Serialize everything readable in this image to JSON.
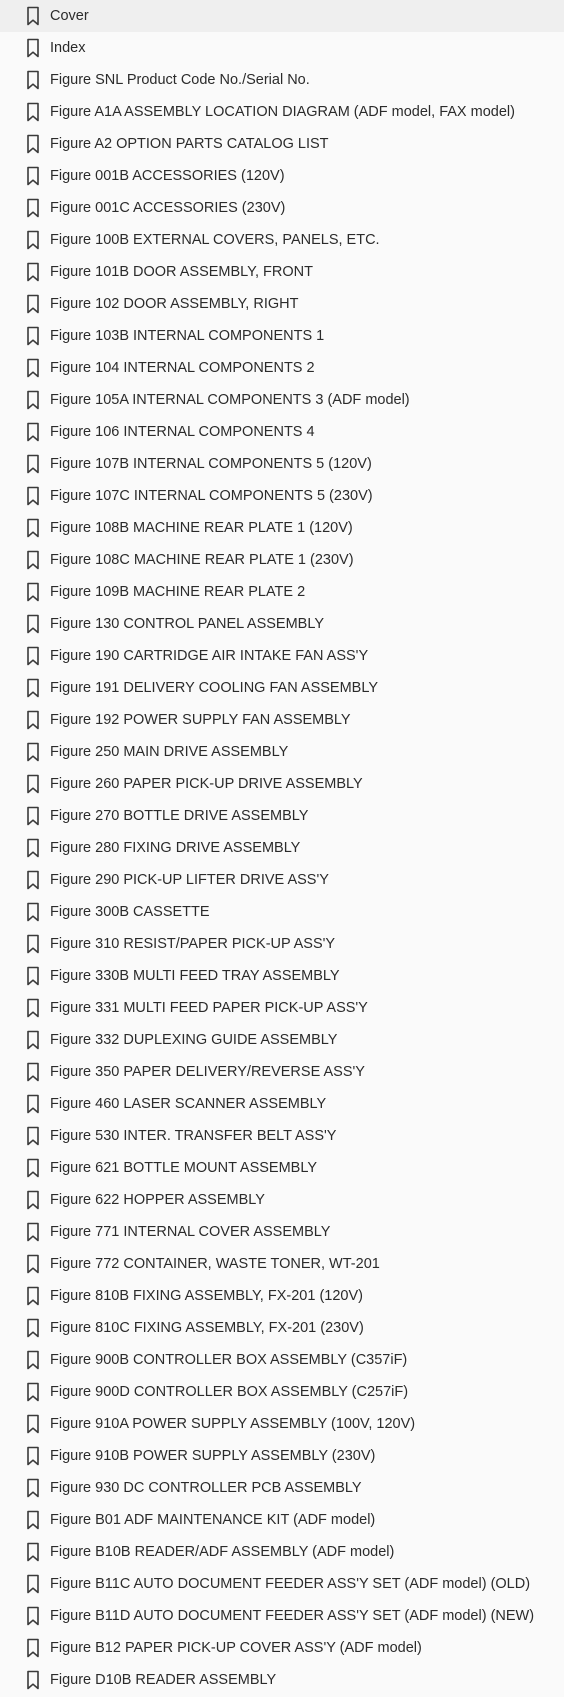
{
  "bookmarks": [
    {
      "label": "Cover",
      "icon": "bookmark-icon"
    },
    {
      "label": "Index",
      "icon": "bookmark-icon"
    },
    {
      "label": "Figure SNL Product Code No./Serial No.",
      "icon": "bookmark-icon"
    },
    {
      "label": "Figure A1A ASSEMBLY LOCATION DIAGRAM (ADF model, FAX model)",
      "icon": "bookmark-icon"
    },
    {
      "label": "Figure A2 OPTION PARTS CATALOG LIST",
      "icon": "bookmark-icon"
    },
    {
      "label": "Figure 001B ACCESSORIES (120V)",
      "icon": "bookmark-icon"
    },
    {
      "label": "Figure 001C ACCESSORIES (230V)",
      "icon": "bookmark-icon"
    },
    {
      "label": "Figure 100B EXTERNAL COVERS, PANELS, ETC.",
      "icon": "bookmark-icon"
    },
    {
      "label": "Figure 101B DOOR ASSEMBLY, FRONT",
      "icon": "bookmark-icon"
    },
    {
      "label": "Figure 102 DOOR ASSEMBLY, RIGHT",
      "icon": "bookmark-icon"
    },
    {
      "label": "Figure 103B INTERNAL COMPONENTS 1",
      "icon": "bookmark-icon"
    },
    {
      "label": "Figure 104 INTERNAL COMPONENTS 2",
      "icon": "bookmark-icon"
    },
    {
      "label": "Figure 105A INTERNAL COMPONENTS 3 (ADF model)",
      "icon": "bookmark-icon"
    },
    {
      "label": "Figure 106 INTERNAL COMPONENTS 4",
      "icon": "bookmark-icon"
    },
    {
      "label": "Figure 107B INTERNAL COMPONENTS 5 (120V)",
      "icon": "bookmark-icon"
    },
    {
      "label": "Figure 107C INTERNAL COMPONENTS 5 (230V)",
      "icon": "bookmark-icon"
    },
    {
      "label": "Figure 108B MACHINE REAR PLATE 1 (120V)",
      "icon": "bookmark-icon"
    },
    {
      "label": "Figure 108C MACHINE REAR PLATE 1 (230V)",
      "icon": "bookmark-icon"
    },
    {
      "label": "Figure 109B MACHINE REAR PLATE 2",
      "icon": "bookmark-icon"
    },
    {
      "label": "Figure 130 CONTROL PANEL ASSEMBLY",
      "icon": "bookmark-icon"
    },
    {
      "label": "Figure 190 CARTRIDGE AIR INTAKE FAN ASS'Y",
      "icon": "bookmark-icon"
    },
    {
      "label": "Figure 191 DELIVERY COOLING FAN ASSEMBLY",
      "icon": "bookmark-icon"
    },
    {
      "label": "Figure 192 POWER SUPPLY FAN ASSEMBLY",
      "icon": "bookmark-icon"
    },
    {
      "label": "Figure 250 MAIN DRIVE ASSEMBLY",
      "icon": "bookmark-icon"
    },
    {
      "label": "Figure 260 PAPER PICK-UP DRIVE ASSEMBLY",
      "icon": "bookmark-icon"
    },
    {
      "label": "Figure 270 BOTTLE DRIVE ASSEMBLY",
      "icon": "bookmark-icon"
    },
    {
      "label": "Figure 280 FIXING DRIVE ASSEMBLY",
      "icon": "bookmark-icon"
    },
    {
      "label": "Figure 290 PICK-UP LIFTER DRIVE ASS'Y",
      "icon": "bookmark-icon"
    },
    {
      "label": "Figure 300B CASSETTE",
      "icon": "bookmark-icon"
    },
    {
      "label": "Figure 310 RESIST/PAPER PICK-UP ASS'Y",
      "icon": "bookmark-icon"
    },
    {
      "label": "Figure 330B MULTI FEED TRAY ASSEMBLY",
      "icon": "bookmark-icon"
    },
    {
      "label": "Figure 331 MULTI FEED PAPER PICK-UP ASS'Y",
      "icon": "bookmark-icon"
    },
    {
      "label": "Figure 332 DUPLEXING GUIDE ASSEMBLY",
      "icon": "bookmark-icon"
    },
    {
      "label": "Figure 350 PAPER DELIVERY/REVERSE ASS'Y",
      "icon": "bookmark-icon"
    },
    {
      "label": "Figure 460 LASER SCANNER ASSEMBLY",
      "icon": "bookmark-icon"
    },
    {
      "label": "Figure 530 INTER. TRANSFER BELT ASS'Y",
      "icon": "bookmark-icon"
    },
    {
      "label": "Figure 621 BOTTLE MOUNT ASSEMBLY",
      "icon": "bookmark-icon"
    },
    {
      "label": "Figure 622 HOPPER ASSEMBLY",
      "icon": "bookmark-icon"
    },
    {
      "label": "Figure 771 INTERNAL COVER ASSEMBLY",
      "icon": "bookmark-icon"
    },
    {
      "label": "Figure 772 CONTAINER, WASTE TONER, WT-201",
      "icon": "bookmark-icon"
    },
    {
      "label": "Figure 810B FIXING ASSEMBLY, FX-201 (120V)",
      "icon": "bookmark-icon"
    },
    {
      "label": "Figure 810C FIXING ASSEMBLY, FX-201 (230V)",
      "icon": "bookmark-icon"
    },
    {
      "label": "Figure 900B CONTROLLER BOX ASSEMBLY (C357iF)",
      "icon": "bookmark-icon"
    },
    {
      "label": "Figure 900D CONTROLLER BOX ASSEMBLY (C257iF)",
      "icon": "bookmark-icon"
    },
    {
      "label": "Figure 910A POWER SUPPLY ASSEMBLY (100V, 120V)",
      "icon": "bookmark-icon"
    },
    {
      "label": "Figure 910B POWER SUPPLY ASSEMBLY (230V)",
      "icon": "bookmark-icon"
    },
    {
      "label": "Figure 930 DC CONTROLLER PCB ASSEMBLY",
      "icon": "bookmark-icon"
    },
    {
      "label": "Figure B01 ADF MAINTENANCE KIT (ADF model)",
      "icon": "bookmark-icon"
    },
    {
      "label": "Figure B10B READER/ADF ASSEMBLY (ADF model)",
      "icon": "bookmark-icon"
    },
    {
      "label": "Figure B11C AUTO DOCUMENT FEEDER ASS'Y SET (ADF model) (OLD)",
      "icon": "bookmark-icon"
    },
    {
      "label": "Figure B11D AUTO DOCUMENT FEEDER ASS'Y SET (ADF model) (NEW)",
      "icon": "bookmark-icon"
    },
    {
      "label": "Figure B12 PAPER PICK-UP COVER ASS'Y (ADF model)",
      "icon": "bookmark-icon"
    },
    {
      "label": "Figure D10B READER ASSEMBLY",
      "icon": "bookmark-icon"
    }
  ],
  "colors": {
    "background": "#fafafa",
    "text": "#2b2b2b",
    "icon_stroke": "#3a3a3a"
  }
}
